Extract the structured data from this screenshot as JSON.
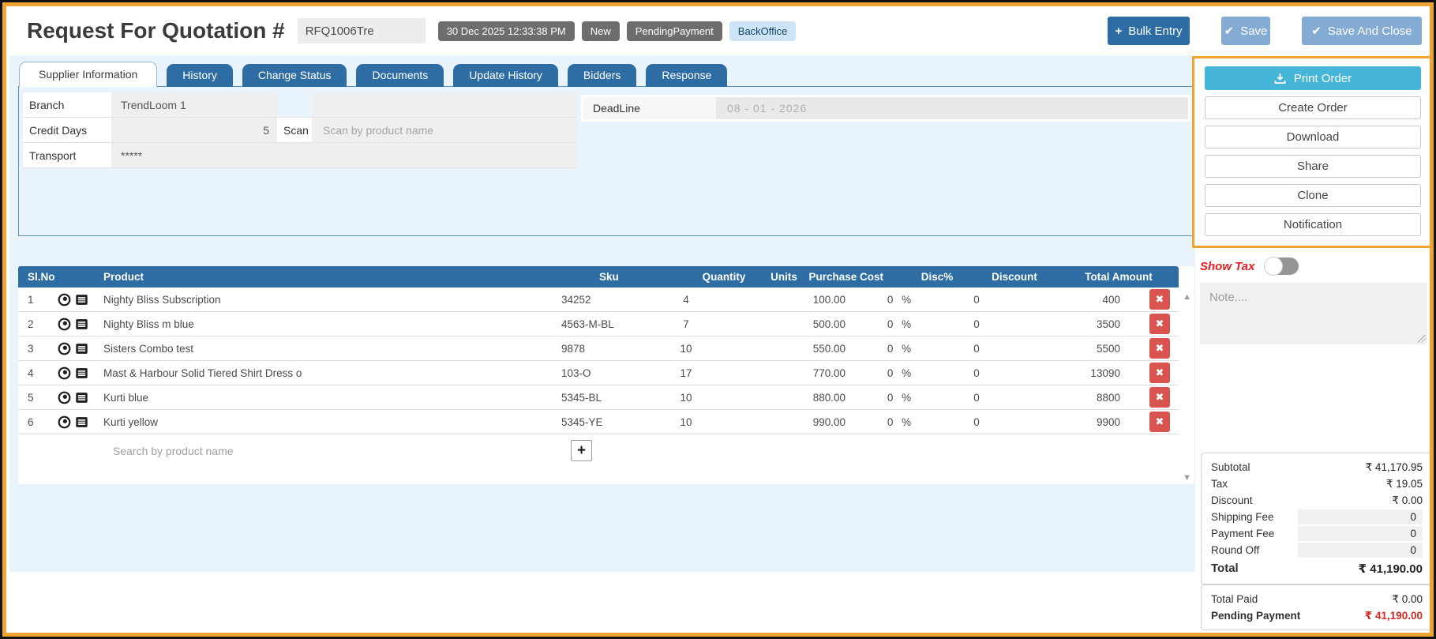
{
  "colors": {
    "accent_blue": "#2e6da4",
    "light_blue_bg": "#e9f3fb",
    "cyan_print": "#45b6d8",
    "highlight_orange": "#f2a430",
    "delete_red": "#d9534f",
    "badge_gray": "#6d6d6d",
    "pending_red": "#cf2b26"
  },
  "header": {
    "title": "Request For Quotation #",
    "rfq_value": "RFQ1006Tre",
    "badges": [
      {
        "label": "30 Dec 2025 12:33:38 PM",
        "cls": "badge-gray"
      },
      {
        "label": "New",
        "cls": "badge-gray"
      },
      {
        "label": "PendingPayment",
        "cls": "badge-gray"
      },
      {
        "label": "BackOffice",
        "cls": "badge-light"
      }
    ],
    "bulk_entry_label": "Bulk Entry",
    "save_label": "Save",
    "save_and_close_label": "Save And Close"
  },
  "tabs": [
    {
      "label": "Supplier Information",
      "cls": "active"
    },
    {
      "label": "History"
    },
    {
      "label": "Change Status"
    },
    {
      "label": "Documents"
    },
    {
      "label": "Update History"
    },
    {
      "label": "Bidders"
    },
    {
      "label": "Response"
    }
  ],
  "form": {
    "branch_label": "Branch",
    "branch_value": "TrendLoom 1",
    "credit_days_label": "Credit Days",
    "credit_days_value": "5",
    "scan_label": "Scan",
    "scan_placeholder": "Scan by product name",
    "transport_label": "Transport",
    "transport_value": "*****",
    "deadline_label": "DeadLine",
    "deadline_value": "08 - 01 - 2026"
  },
  "side_panel": {
    "print_order_label": "Print Order",
    "buttons": [
      {
        "label": "Create Order"
      },
      {
        "label": "Download"
      },
      {
        "label": "Share"
      },
      {
        "label": "Clone"
      },
      {
        "label": "Notification"
      }
    ],
    "show_tax_label": "Show Tax",
    "note_placeholder": "Note...."
  },
  "table": {
    "columns": [
      {
        "label": "Sl.No",
        "cls": "col-sl"
      },
      {
        "label": "Product",
        "cls": "col-product-h"
      },
      {
        "label": "Sku",
        "cls": "col-sku"
      },
      {
        "label": "Quantity",
        "cls": "col-qty"
      },
      {
        "label": "Units",
        "cls": "col-units"
      },
      {
        "label": "Purchase Cost",
        "cls": "col-cost"
      },
      {
        "label": "Disc%",
        "cls": "col-disc"
      },
      {
        "label": "Discount",
        "cls": "col-discount"
      },
      {
        "label": "Total Amount",
        "cls": "col-total"
      }
    ],
    "rows": [
      {
        "sl": "1",
        "product": "Nighty Bliss Subscription",
        "sku": "34252",
        "quantity": "4",
        "units": "",
        "purchase_cost": "100.00",
        "disc_pct": "0 %",
        "discount": "0",
        "total": "400"
      },
      {
        "sl": "2",
        "product": "Nighty Bliss m blue",
        "sku": "4563-M-BL",
        "quantity": "7",
        "units": "",
        "purchase_cost": "500.00",
        "disc_pct": "0 %",
        "discount": "0",
        "total": "3500"
      },
      {
        "sl": "3",
        "product": "Sisters Combo test",
        "sku": "9878",
        "quantity": "10",
        "units": "",
        "purchase_cost": "550.00",
        "disc_pct": "0 %",
        "discount": "0",
        "total": "5500"
      },
      {
        "sl": "4",
        "product": "Mast & Harbour Solid Tiered Shirt Dress o",
        "sku": "103-O",
        "quantity": "17",
        "units": "",
        "purchase_cost": "770.00",
        "disc_pct": "0 %",
        "discount": "0",
        "total": "13090"
      },
      {
        "sl": "5",
        "product": "Kurti blue",
        "sku": "5345-BL",
        "quantity": "10",
        "units": "",
        "purchase_cost": "880.00",
        "disc_pct": "0 %",
        "discount": "0",
        "total": "8800"
      },
      {
        "sl": "6",
        "product": "Kurti yellow",
        "sku": "5345-YE",
        "quantity": "10",
        "units": "",
        "purchase_cost": "990.00",
        "disc_pct": "0 %",
        "discount": "0",
        "total": "9900"
      }
    ],
    "search_placeholder": "Search by product name",
    "add_button_label": "+"
  },
  "summary": {
    "totals": [
      {
        "label": "Subtotal",
        "value": "₹ 41,170.95"
      },
      {
        "label": "Tax",
        "value": "₹ 19.05"
      },
      {
        "label": "Discount",
        "value": "₹ 0.00"
      },
      {
        "label": "Shipping Fee",
        "value": "0",
        "cls": "row-input"
      },
      {
        "label": "Payment Fee",
        "value": "0",
        "cls": "row-input"
      },
      {
        "label": "Round Off",
        "value": "0",
        "cls": "row-input"
      },
      {
        "label": "Total",
        "value": "₹ 41,190.00",
        "cls": "row-total"
      }
    ],
    "payments": [
      {
        "label": "Total Paid",
        "value": "₹ 0.00"
      },
      {
        "label": "Pending Payment",
        "value": "₹ 41,190.00",
        "cls": "row-red"
      }
    ]
  }
}
